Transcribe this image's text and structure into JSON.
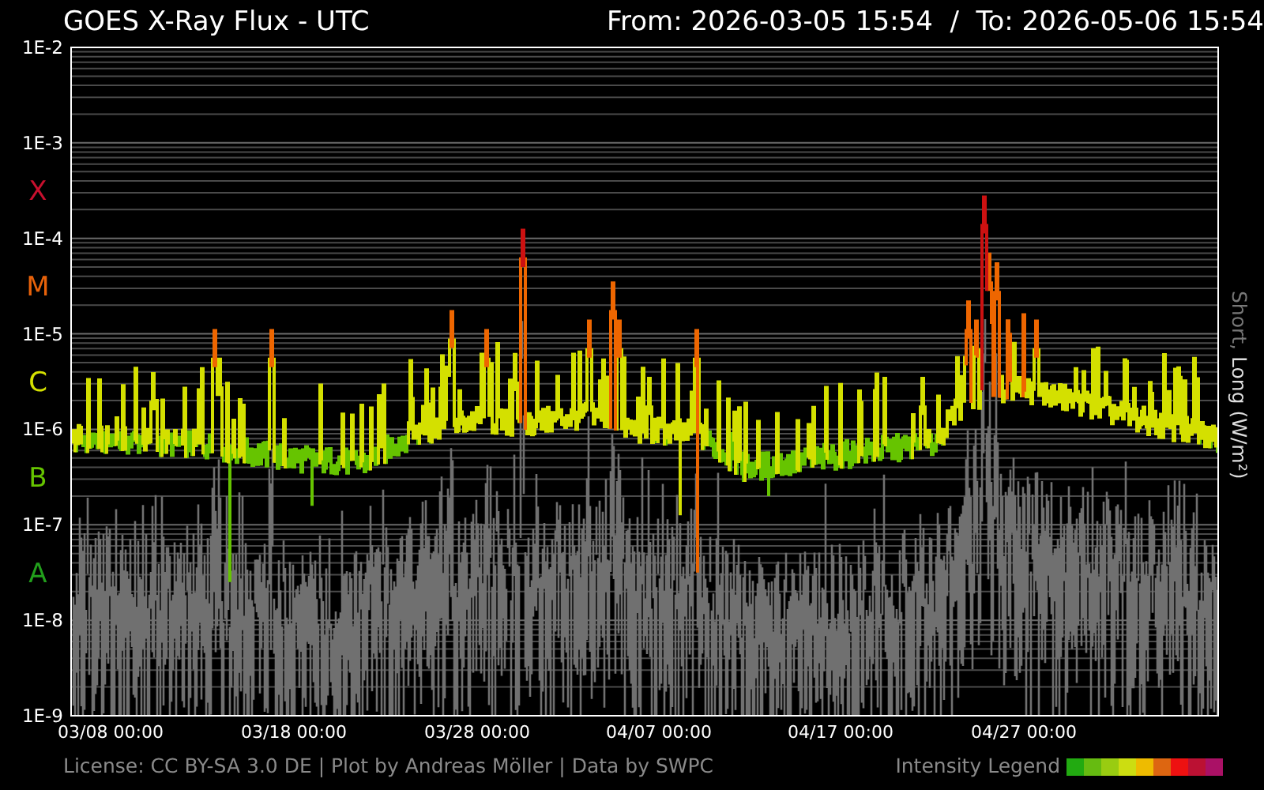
{
  "title": "GOES X-Ray Flux - UTC",
  "range": "From: 2026-03-05 15:54  /  To: 2026-05-06 15:54",
  "y_ticks": [
    "1E-2",
    "1E-3",
    "1E-4",
    "1E-5",
    "1E-6",
    "1E-7",
    "1E-8",
    "1E-9"
  ],
  "flare_classes": [
    {
      "label": "X",
      "color": "#c8102e"
    },
    {
      "label": "M",
      "color": "#e8620a"
    },
    {
      "label": "C",
      "color": "#d4e000"
    },
    {
      "label": "B",
      "color": "#66c400"
    },
    {
      "label": "A",
      "color": "#22a01c"
    }
  ],
  "x_ticks": [
    "03/08 00:00",
    "03/18 00:00",
    "03/28 00:00",
    "04/07 00:00",
    "04/17 00:00",
    "04/27 00:00"
  ],
  "y_axis_title": {
    "short": "Short,",
    "long": "Long (W/m²)"
  },
  "footer": "License: CC BY-SA 3.0 DE | Plot by Andreas Möller | Data by SWPC",
  "legend": {
    "label": "Intensity Legend"
  }
}
